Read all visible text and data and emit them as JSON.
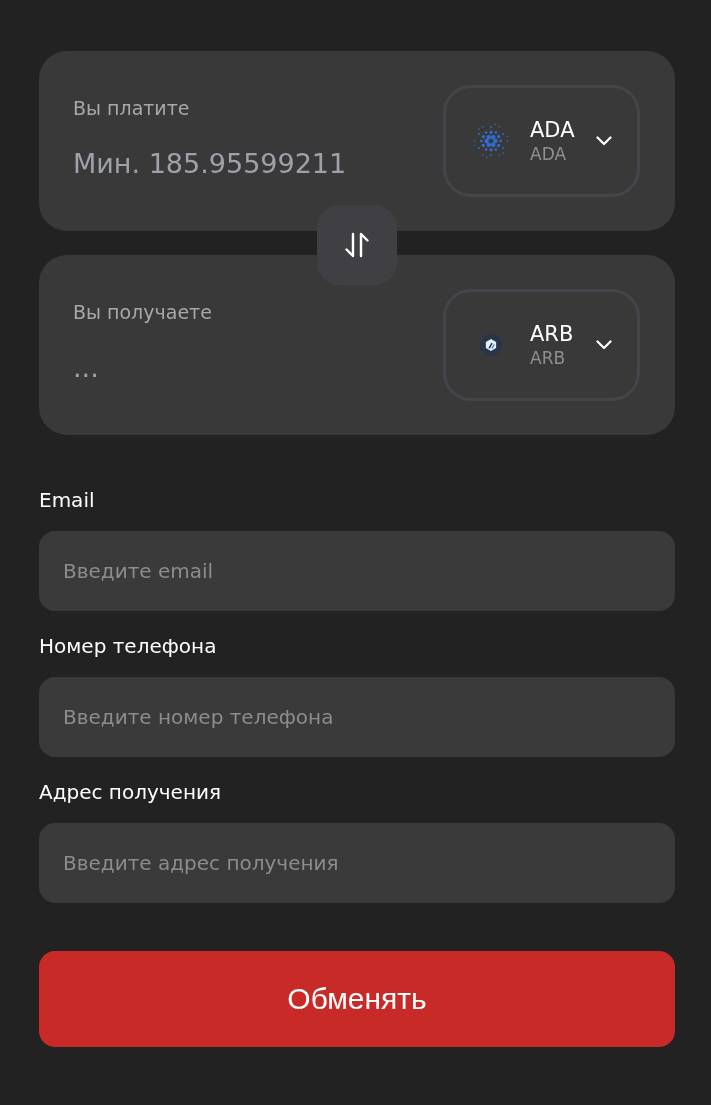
{
  "panels": [
    {
      "label": "Вы платите",
      "placeholder": "Мин. 185.95599211",
      "currency": {
        "symbol": "ADA",
        "network": "ADA",
        "kind": "ada"
      }
    },
    {
      "label": "Вы получаете",
      "placeholder": "...",
      "currency": {
        "symbol": "ARB",
        "network": "ARB",
        "kind": "arb"
      }
    }
  ],
  "fields": [
    {
      "label": "Email",
      "placeholder": "Введите email"
    },
    {
      "label": "Номер телефона",
      "placeholder": "Введите номер телефона"
    },
    {
      "label": "Адрес получения",
      "placeholder": "Введите адрес получения"
    }
  ],
  "submit_button": {
    "label": "Обменять"
  }
}
